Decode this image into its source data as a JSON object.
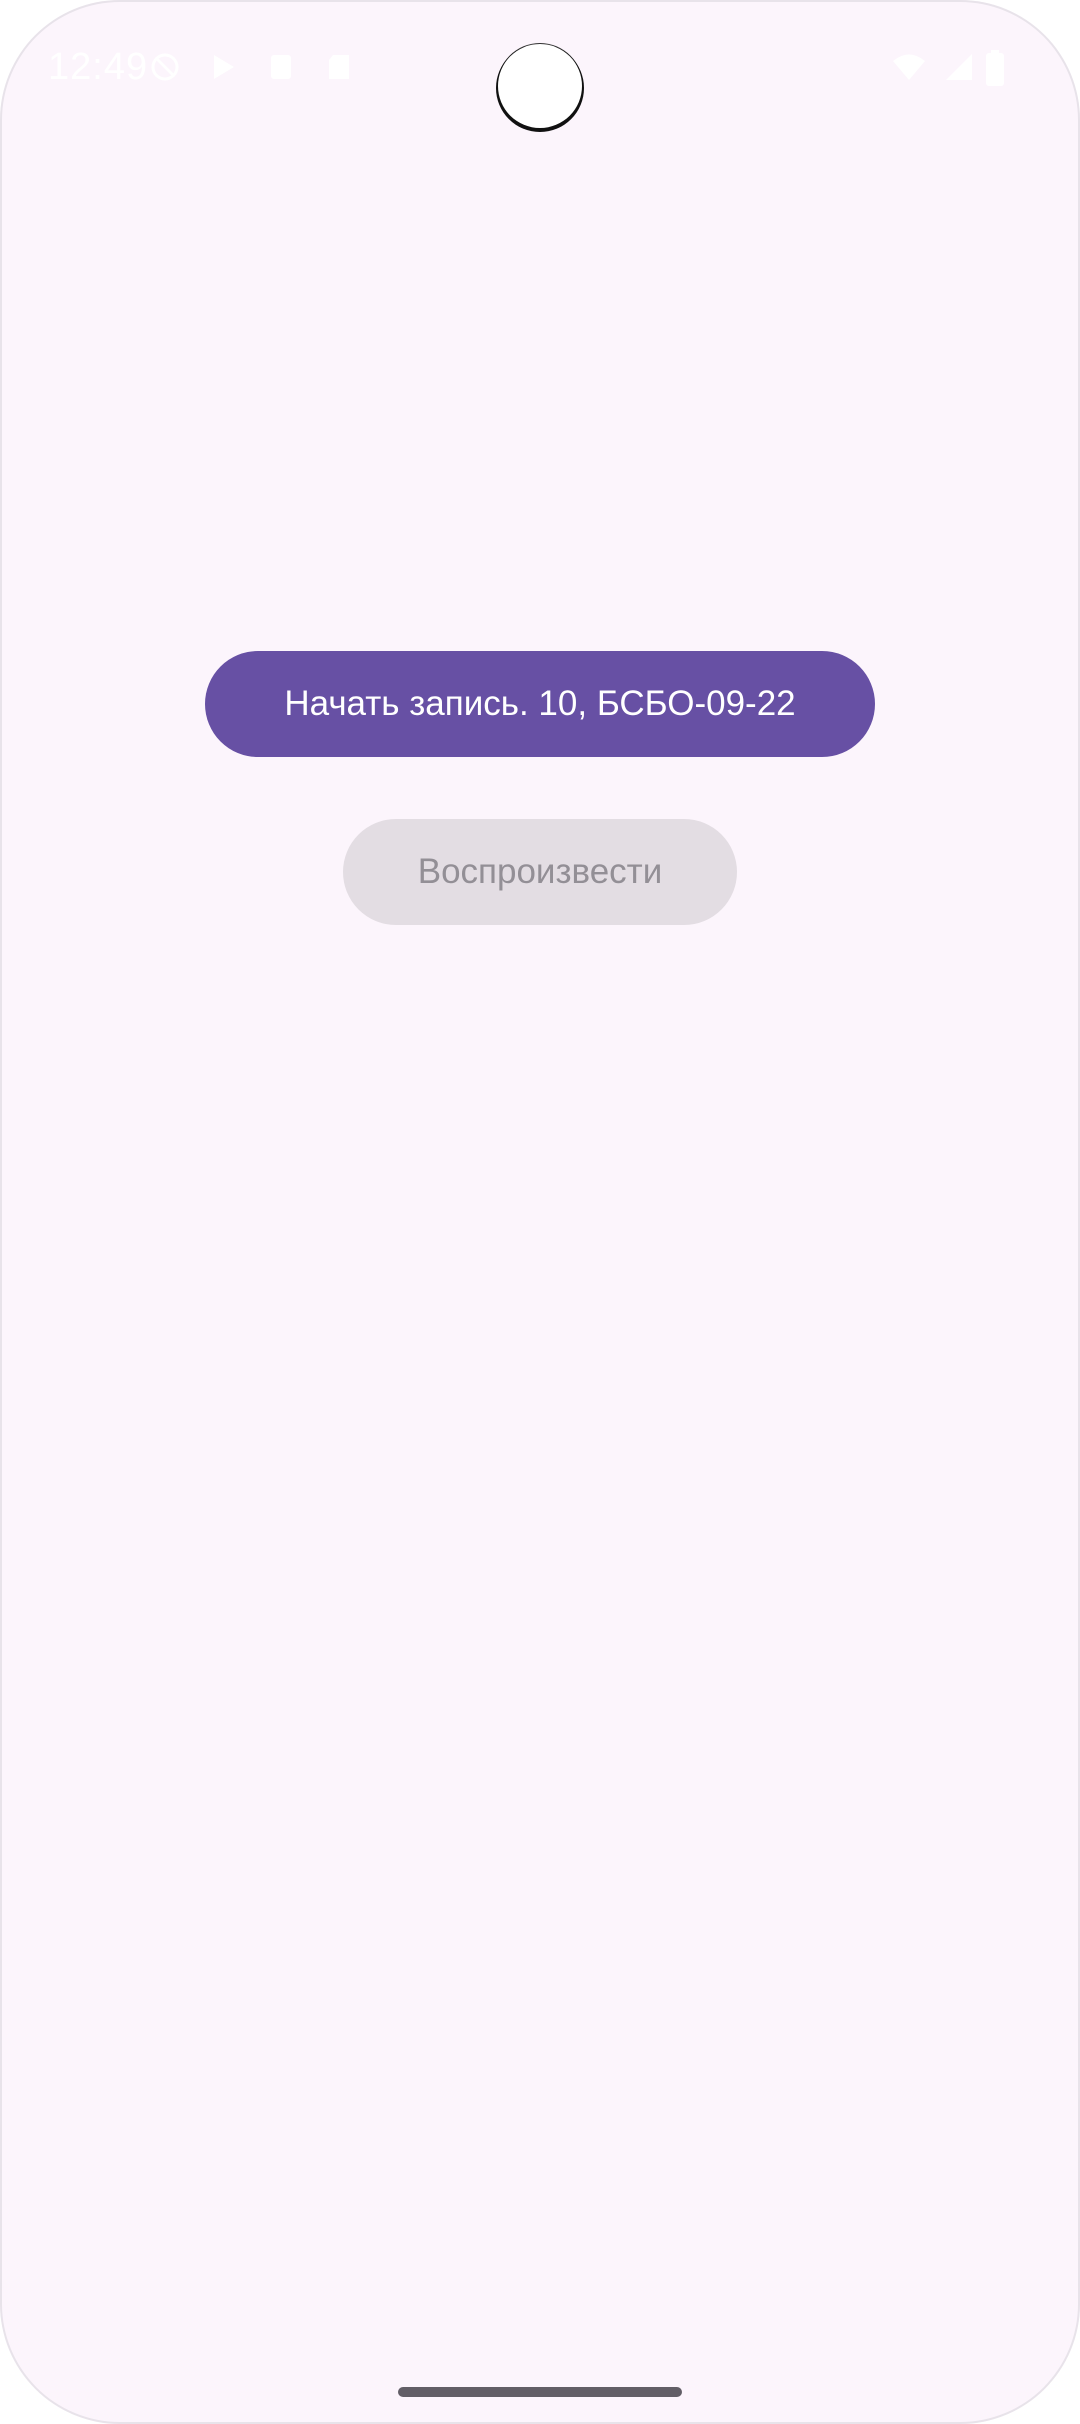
{
  "status_bar": {
    "time": "12:49",
    "left_icons": [
      "do-not-disturb-icon",
      "play-store-icon",
      "notification-icon",
      "sd-card-icon"
    ],
    "right_icons": [
      "wifi-icon",
      "cellular-signal-icon",
      "battery-icon"
    ]
  },
  "main": {
    "record_button_label": "Начать запись. 10, БСБО-09-22",
    "play_button_label": "Воспроизвести"
  },
  "colors": {
    "background": "#fcf5fc",
    "primary": "#6750a4",
    "disabled_bg": "#e3dde3",
    "disabled_text": "#938f96"
  }
}
